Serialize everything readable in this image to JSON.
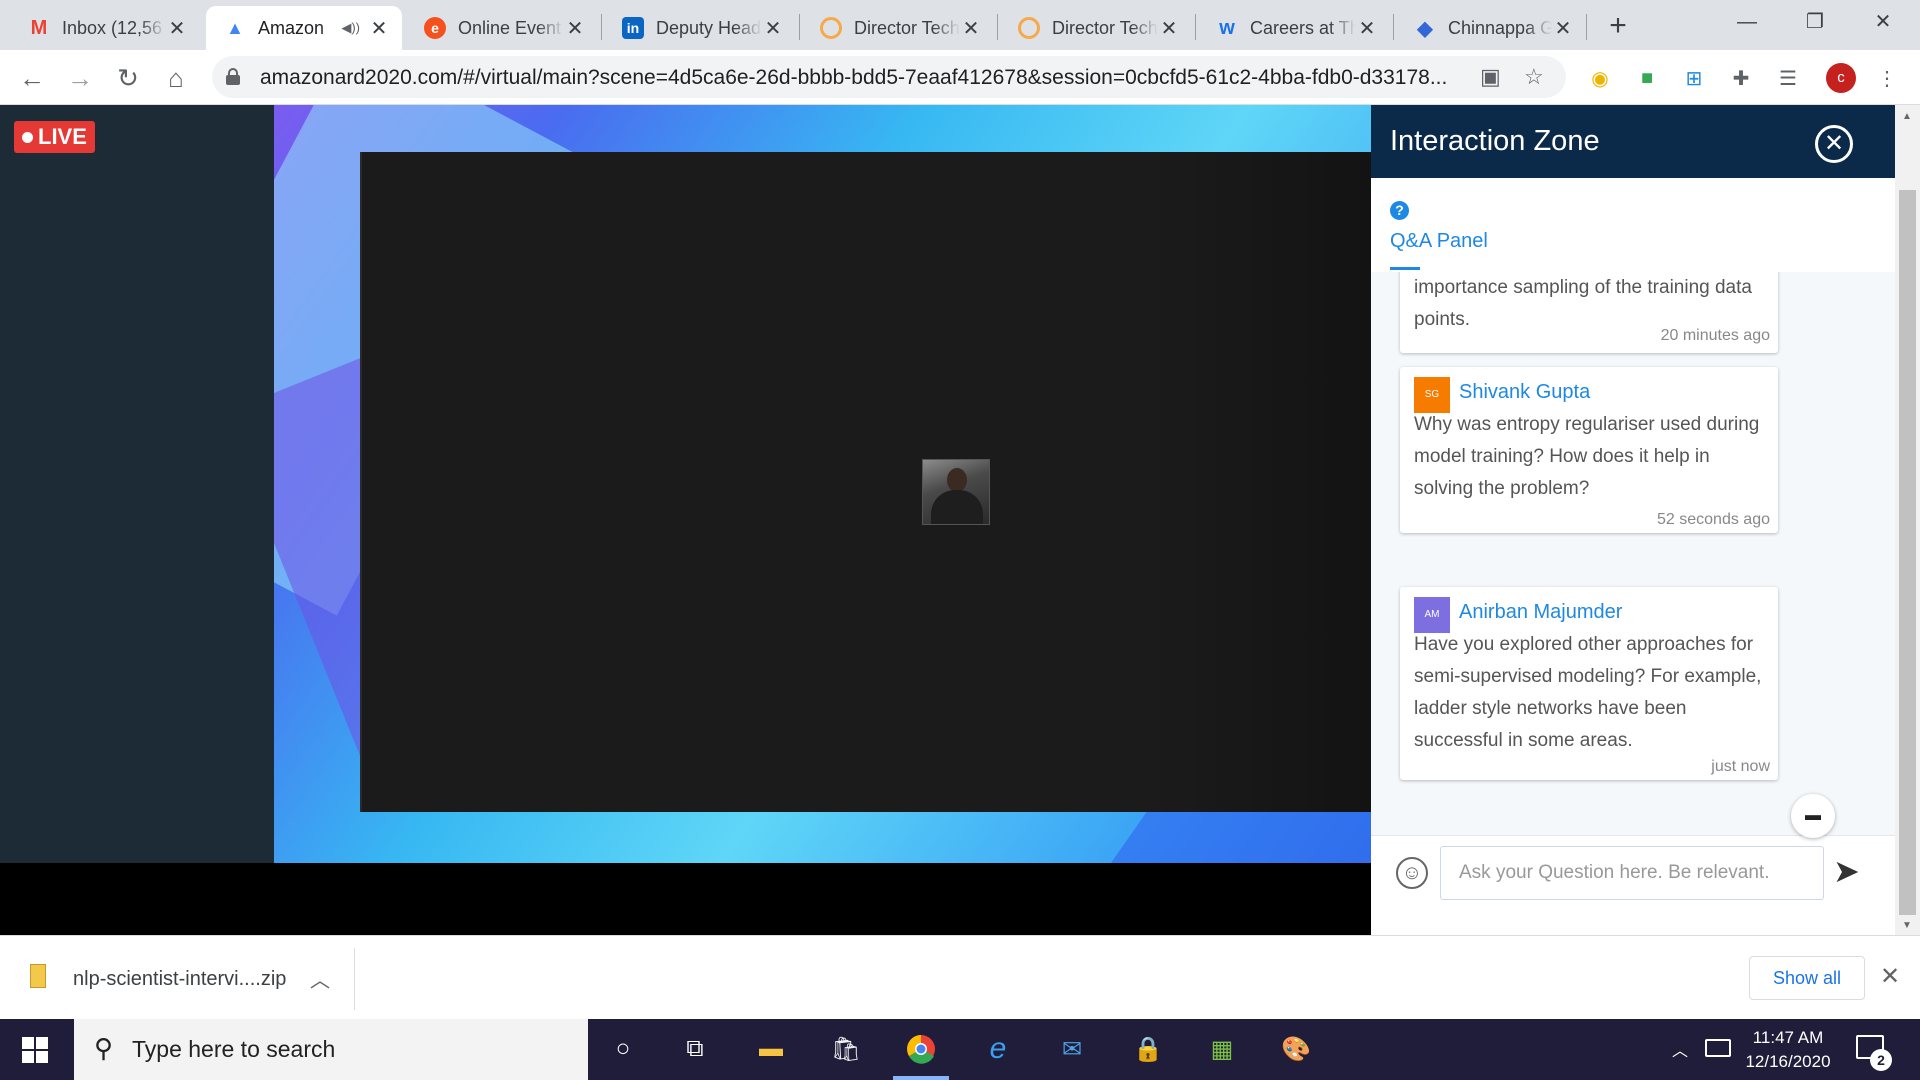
{
  "browser": {
    "tabs": [
      {
        "title": "Inbox (12,56",
        "favicon": "gmail-icon",
        "color": "#ea4335"
      },
      {
        "title": "Amazon",
        "favicon": "amazon-event-icon",
        "color": "#4285f4",
        "active": true,
        "audio": true
      },
      {
        "title": "Online Event",
        "favicon": "event-e-icon",
        "color": "#f4511e"
      },
      {
        "title": "Deputy Head",
        "favicon": "linkedin-icon",
        "color": "#0a66c2"
      },
      {
        "title": "Director Tech",
        "favicon": "ring-icon",
        "color": "#f6a94b"
      },
      {
        "title": "Director Tech",
        "favicon": "ring-icon",
        "color": "#f6a94b"
      },
      {
        "title": "Careers at Th",
        "favicon": "careers-w-icon",
        "color": "#1a73e8"
      },
      {
        "title": "Chinnappa G",
        "favicon": "diamond-icon",
        "color": "#3367d6"
      }
    ],
    "url": "amazonard2020.com/#/virtual/main?scene=4d5ca6e-26d-bbbb-bdd5-7eaaf412678&session=0cbcfd5-61c2-4bba-fdb0-d33178...",
    "profile_initial": "c"
  },
  "stage": {
    "live_label": "LIVE"
  },
  "panel": {
    "title": "Interaction Zone",
    "tab_label": "Q&A Panel",
    "messages": [
      {
        "name": "",
        "initials": "",
        "avatar_color": "",
        "text": "importance sampling of the training data points.",
        "time": "20 minutes ago"
      },
      {
        "name": "Shivank Gupta",
        "initials": "SG",
        "avatar_color": "#f57c00",
        "text": "Why was entropy regulariser used during model training? How does it help in solving the problem?",
        "time": "52 seconds ago"
      },
      {
        "name": "Anirban Majumder",
        "initials": "AM",
        "avatar_color": "#7e6fe0",
        "text": "Have you explored other approaches for semi-supervised modeling? For example, ladder style networks have been successful in some areas.",
        "time": "just now"
      }
    ],
    "input_placeholder": "Ask your Question here. Be relevant."
  },
  "downloads": {
    "file_name": "nlp-scientist-intervi....zip",
    "show_all_label": "Show all"
  },
  "taskbar": {
    "search_placeholder": "Type here to search",
    "time": "11:47 AM",
    "date": "12/16/2020",
    "notification_count": "2"
  }
}
